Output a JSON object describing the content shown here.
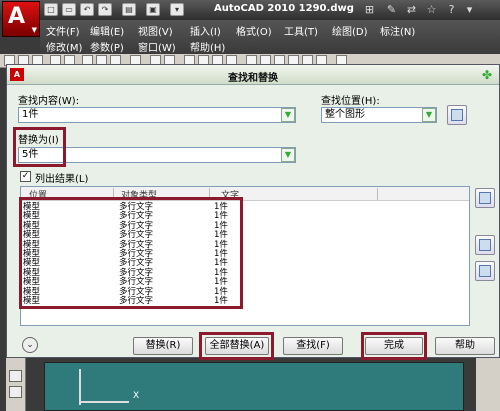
{
  "app": {
    "title": "AutoCAD 2010    1290.dwg",
    "logo_letter": "A",
    "quick_access": [
      "new-icon",
      "open-icon",
      "save-icon",
      "undo-icon",
      "redo-icon",
      "print-icon",
      "folder-icon"
    ],
    "title_icons": [
      "binoculars-icon",
      "tools-icon",
      "exchange-icon",
      "star-icon",
      "help-icon",
      "dropdown-icon"
    ]
  },
  "menu": {
    "row1": [
      "文件(F)",
      "编辑(E)",
      "视图(V)",
      "插入(I)",
      "格式(O)",
      "工具(T)",
      "绘图(D)",
      "标注(N)"
    ],
    "row2": [
      "修改(M)",
      "参数(P)",
      "窗口(W)",
      "帮助(H)"
    ]
  },
  "dialog": {
    "title": "查找和替换",
    "find_label": "查找内容(W):",
    "find_value": "1件",
    "scope_label": "查找位置(H):",
    "scope_value": "整个图形",
    "replace_label": "替换为(I)",
    "replace_value": "5件",
    "list_results_label": "列出结果(L)",
    "list_results_checked": "✓",
    "columns": [
      "位置",
      "对象类型",
      "文字"
    ],
    "results": [
      {
        "location": "模型",
        "type": "多行文字",
        "text": "1件"
      },
      {
        "location": "模型",
        "type": "多行文字",
        "text": "1件"
      },
      {
        "location": "模型",
        "type": "多行文字",
        "text": "1件"
      },
      {
        "location": "模型",
        "type": "多行文字",
        "text": "1件"
      },
      {
        "location": "模型",
        "type": "多行文字",
        "text": "1件"
      },
      {
        "location": "模型",
        "type": "多行文字",
        "text": "1件"
      },
      {
        "location": "模型",
        "type": "多行文字",
        "text": "1件"
      },
      {
        "location": "模型",
        "type": "多行文字",
        "text": "1件"
      },
      {
        "location": "模型",
        "type": "多行文字",
        "text": "1件"
      },
      {
        "location": "模型",
        "type": "多行文字",
        "text": "1件"
      },
      {
        "location": "模型",
        "type": "多行文字",
        "text": "1件"
      }
    ],
    "buttons": {
      "replace": "替换(R)",
      "replace_all": "全部替换(A)",
      "find": "查找(F)",
      "done": "完成",
      "help": "帮助"
    },
    "highlight_color": "#8b1a2e"
  },
  "canvas": {
    "axis_label": "X",
    "background": "#2f7a7a"
  }
}
